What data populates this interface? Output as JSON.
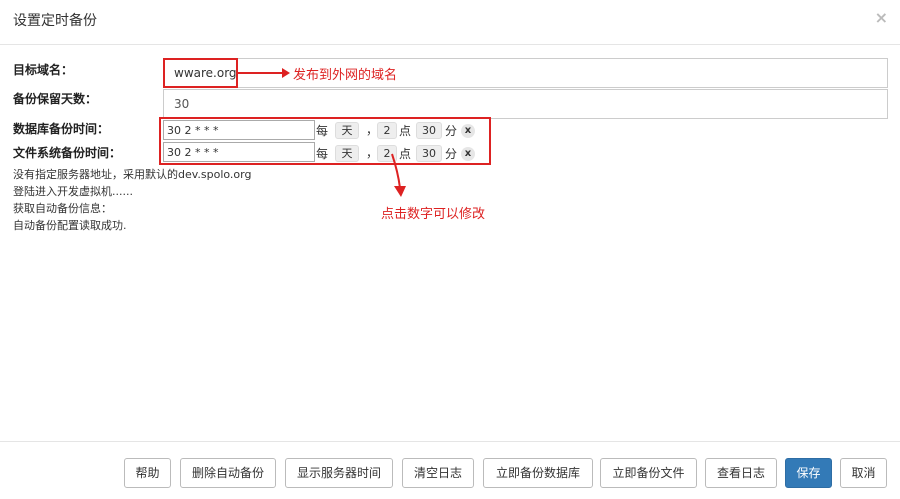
{
  "dialog": {
    "title": "设置定时备份",
    "close_icon": "×"
  },
  "form": {
    "domain_label": "目标域名：",
    "domain_value": "wware.org",
    "retention_label": "备份保留天数：",
    "retention_value": "30",
    "db_time_label": "数据库备份时间：",
    "db_cron": "30 2 * * *",
    "file_time_label": "文件系统备份时间：",
    "file_cron": "30 2 * * *",
    "schedule": {
      "every": "每",
      "day": "天",
      "comma": "，",
      "hour": "2",
      "hour_unit": "点",
      "minute": "30",
      "minute_unit": "分",
      "clear_icon": "x"
    }
  },
  "annotations": {
    "domain_note": "发布到外网的域名",
    "click_note": "点击数字可以修改",
    "color": "#dd2222"
  },
  "log": [
    "没有指定服务器地址，采用默认的dev.spolo.org",
    "登陆进入开发虚拟机......",
    "获取自动备份信息：",
    "自动备份配置读取成功."
  ],
  "buttons": {
    "help": "帮助",
    "delete_auto": "删除自动备份",
    "show_server_time": "显示服务器时间",
    "clear_log": "清空日志",
    "backup_db_now": "立即备份数据库",
    "backup_files_now": "立即备份文件",
    "view_log": "查看日志",
    "save": "保存",
    "cancel": "取消"
  },
  "colors": {
    "primary": "#337ab7"
  }
}
